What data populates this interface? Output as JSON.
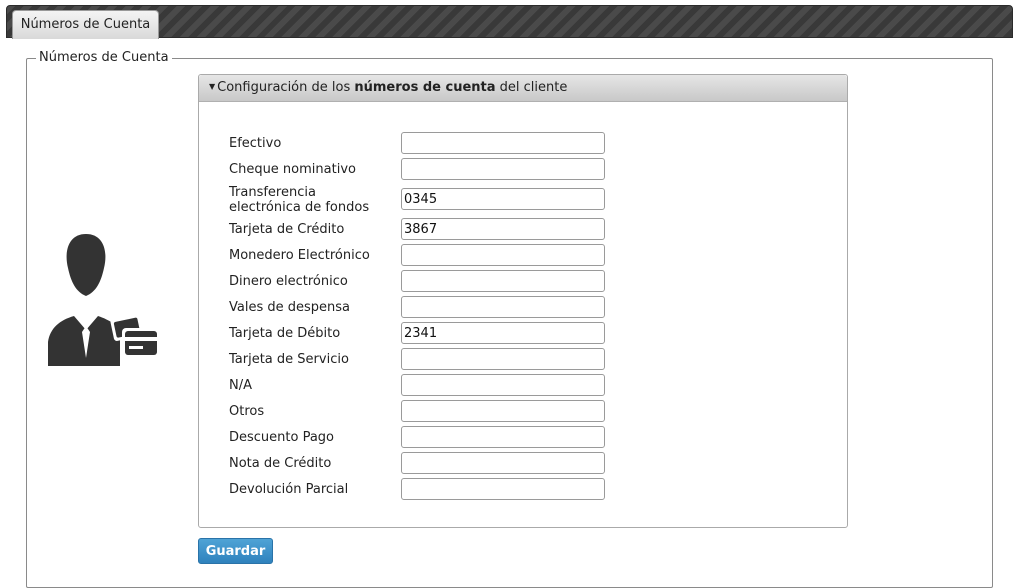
{
  "tabs": [
    {
      "label": "Números de Cuenta"
    }
  ],
  "fieldset": {
    "legend": "Números de Cuenta"
  },
  "avatar": {
    "icon": "user-credit-card-icon"
  },
  "panel": {
    "header_prefix": "Configuración de los ",
    "header_bold": "números de cuenta",
    "header_suffix": " del cliente",
    "fields": [
      {
        "label": "Efectivo",
        "value": ""
      },
      {
        "label": "Cheque nominativo",
        "value": ""
      },
      {
        "label": "Transferencia electrónica de fondos",
        "value": "0345"
      },
      {
        "label": "Tarjeta de Crédito",
        "value": "3867"
      },
      {
        "label": "Monedero Electrónico",
        "value": ""
      },
      {
        "label": "Dinero electrónico",
        "value": ""
      },
      {
        "label": "Vales de despensa",
        "value": ""
      },
      {
        "label": "Tarjeta de Débito",
        "value": "2341"
      },
      {
        "label": "Tarjeta de Servicio",
        "value": ""
      },
      {
        "label": "N/A",
        "value": ""
      },
      {
        "label": "Otros",
        "value": ""
      },
      {
        "label": "Descuento Pago",
        "value": ""
      },
      {
        "label": "Nota de Crédito",
        "value": ""
      },
      {
        "label": "Devolución Parcial",
        "value": ""
      }
    ]
  },
  "actions": {
    "save_label": "Guardar"
  },
  "colors": {
    "primary_button": "#3a8fc8",
    "tabbar": "#3f3f3f"
  }
}
